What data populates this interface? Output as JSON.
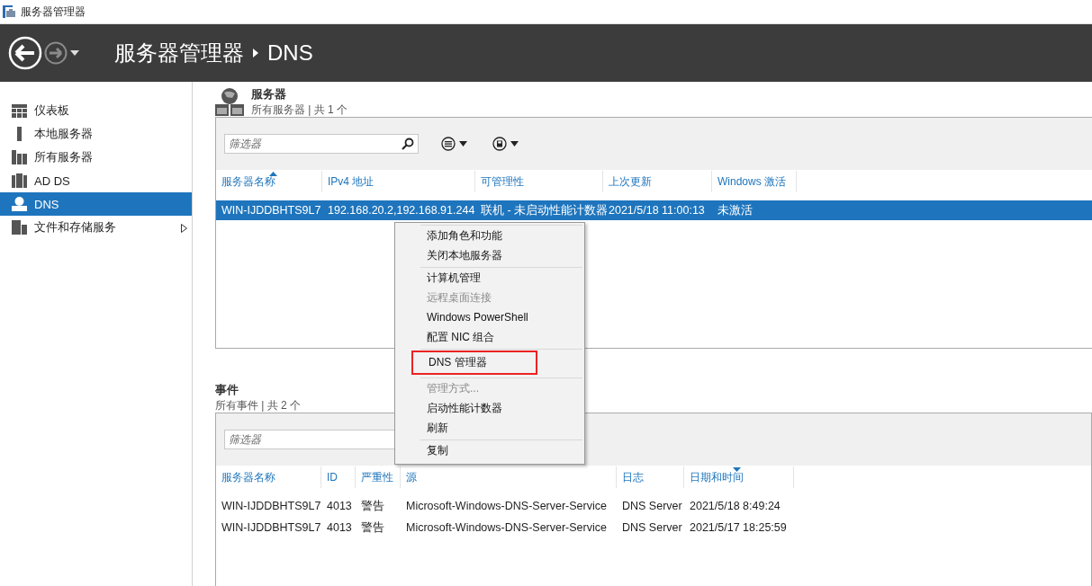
{
  "window": {
    "title": "服务器管理器"
  },
  "header": {
    "breadcrumb": [
      "服务器管理器",
      "DNS"
    ]
  },
  "sidebar": {
    "items": [
      {
        "label": "仪表板",
        "kind": "dashboard",
        "selected": false,
        "has_submenu": false
      },
      {
        "label": "本地服务器",
        "kind": "local",
        "selected": false,
        "has_submenu": false
      },
      {
        "label": "所有服务器",
        "kind": "all",
        "selected": false,
        "has_submenu": false
      },
      {
        "label": "AD DS",
        "kind": "adds",
        "selected": false,
        "has_submenu": false
      },
      {
        "label": "DNS",
        "kind": "dns",
        "selected": true,
        "has_submenu": false
      },
      {
        "label": "文件和存储服务",
        "kind": "files",
        "selected": false,
        "has_submenu": true
      }
    ]
  },
  "servers": {
    "title": "服务器",
    "subtitle": "所有服务器 | 共 1 个",
    "filter": {
      "placeholder": "筛选器"
    },
    "table": {
      "columns": [
        {
          "label": "服务器名称",
          "sort_ascending": true,
          "sort_descending": false
        },
        {
          "label": "IPv4 地址",
          "sort_ascending": false,
          "sort_descending": false
        },
        {
          "label": "可管理性",
          "sort_ascending": false,
          "sort_descending": false
        },
        {
          "label": "上次更新",
          "sort_ascending": false,
          "sort_descending": false
        },
        {
          "label": "Windows 激活",
          "sort_ascending": false,
          "sort_descending": false
        }
      ],
      "rows": [
        {
          "selected": true,
          "cells": [
            "WIN-IJDDBHTS9L7",
            "192.168.20.2,192.168.91.244",
            "联机 - 未启动性能计数器",
            "2021/5/18 11:00:13",
            "未激活"
          ]
        }
      ]
    }
  },
  "context_menu": {
    "groups": [
      [
        {
          "label": "添加角色和功能",
          "disabled": false,
          "highlighted": false
        },
        {
          "label": "关闭本地服务器",
          "disabled": false,
          "highlighted": false
        }
      ],
      [
        {
          "label": "计算机管理",
          "disabled": false,
          "highlighted": false
        },
        {
          "label": "远程桌面连接",
          "disabled": true,
          "highlighted": false
        },
        {
          "label": "Windows PowerShell",
          "disabled": false,
          "highlighted": false
        },
        {
          "label": "配置 NIC 组合",
          "disabled": false,
          "highlighted": false
        }
      ],
      [
        {
          "label": "DNS 管理器",
          "disabled": false,
          "highlighted": true
        }
      ],
      [
        {
          "label": "管理方式...",
          "disabled": true,
          "highlighted": false
        },
        {
          "label": "启动性能计数器",
          "disabled": false,
          "highlighted": false
        },
        {
          "label": "刷新",
          "disabled": false,
          "highlighted": false
        }
      ],
      [
        {
          "label": "复制",
          "disabled": false,
          "highlighted": false
        }
      ]
    ]
  },
  "events": {
    "title": "事件",
    "subtitle": "所有事件 | 共 2 个",
    "filter": {
      "placeholder": "筛选器"
    },
    "table": {
      "columns": [
        {
          "label": "服务器名称",
          "sort_ascending": false,
          "sort_descending": false
        },
        {
          "label": "ID",
          "sort_ascending": false,
          "sort_descending": false
        },
        {
          "label": "严重性",
          "sort_ascending": false,
          "sort_descending": false
        },
        {
          "label": "源",
          "sort_ascending": false,
          "sort_descending": false
        },
        {
          "label": "日志",
          "sort_ascending": false,
          "sort_descending": false
        },
        {
          "label": "日期和时间",
          "sort_ascending": false,
          "sort_descending": true
        }
      ],
      "rows": [
        {
          "selected": false,
          "cells": [
            "WIN-IJDDBHTS9L7",
            "4013",
            "警告",
            "Microsoft-Windows-DNS-Server-Service",
            "DNS Server",
            "2021/5/18 8:49:24"
          ]
        },
        {
          "selected": false,
          "cells": [
            "WIN-IJDDBHTS9L7",
            "4013",
            "警告",
            "Microsoft-Windows-DNS-Server-Service",
            "DNS Server",
            "2021/5/17 18:25:59"
          ]
        }
      ]
    }
  }
}
